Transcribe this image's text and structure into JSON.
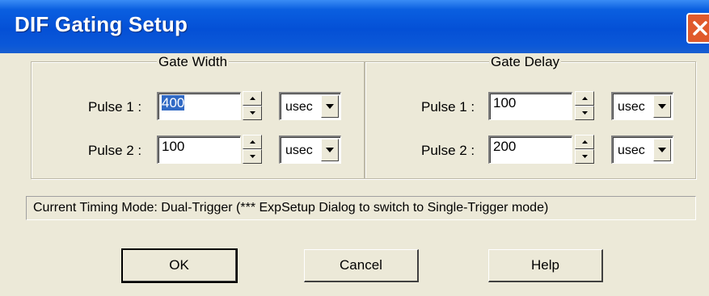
{
  "window": {
    "title": "DIF Gating Setup"
  },
  "gate_width": {
    "legend": "Gate Width",
    "pulse1": {
      "label": "Pulse 1 :",
      "value": "400",
      "unit": "usec"
    },
    "pulse2": {
      "label": "Pulse 2 :",
      "value": "100",
      "unit": "usec"
    }
  },
  "gate_delay": {
    "legend": "Gate Delay",
    "pulse1": {
      "label": "Pulse 1 :",
      "value": "100",
      "unit": "usec"
    },
    "pulse2": {
      "label": "Pulse 2 :",
      "value": "200",
      "unit": "usec"
    }
  },
  "status": {
    "text": "Current Timing Mode: Dual-Trigger (*** ExpSetup Dialog to switch to Single-Trigger mode)"
  },
  "buttons": {
    "ok": "OK",
    "cancel": "Cancel",
    "help": "Help"
  },
  "colors": {
    "titlebar": "#0450d6",
    "close": "#e05a2c",
    "dialog_bg": "#ece9d8",
    "selection": "#316ac5"
  }
}
